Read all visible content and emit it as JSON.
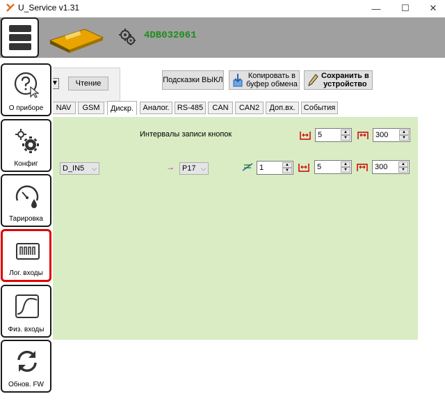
{
  "window": {
    "title": "U_Service v1.31",
    "minimize": "—",
    "maximize": "☐",
    "close": "✕"
  },
  "header": {
    "device_id": "4DB032061"
  },
  "toolbar": {
    "read_label": "Чтение",
    "hints_label": "Подсказки ВЫКЛ",
    "copy_label_1": "Копировать в",
    "copy_label_2": "буфер обмена",
    "save_label_1": "Сохранить в",
    "save_label_2": "устройство"
  },
  "tabs": [
    "NAV",
    "GSM",
    "Дискр.",
    "Аналог.",
    "RS-485",
    "CAN",
    "CAN2",
    "Доп.вх.",
    "События"
  ],
  "active_tab": "Дискр.",
  "panel": {
    "button_intervals_label": "Интервалы записи кнопок",
    "row1": {
      "value_a": "5",
      "value_b": "300"
    },
    "row2": {
      "input_select": "D_IN5",
      "param_select": "P17",
      "value_filter": "1",
      "value_a": "5",
      "value_b": "300"
    }
  },
  "sidebar": {
    "items": [
      {
        "label": "О приборе",
        "icon": "help-cursor-icon"
      },
      {
        "label": "Конфиг",
        "icon": "gears-icon"
      },
      {
        "label": "Тарировка",
        "icon": "gauge-drop-icon"
      },
      {
        "label": "Лог. входы",
        "icon": "logic-inputs-icon",
        "selected": true
      },
      {
        "label": "Физ. входы",
        "icon": "sine-wave-icon"
      },
      {
        "label": "Обнов. FW",
        "icon": "refresh-icon"
      }
    ]
  },
  "colors": {
    "panel_bg": "#d9ecc3",
    "header_bg": "#a0a0a0",
    "device_id": "#1e8c1e",
    "selected_border": "#e00000",
    "accent_red": "#d00000"
  }
}
